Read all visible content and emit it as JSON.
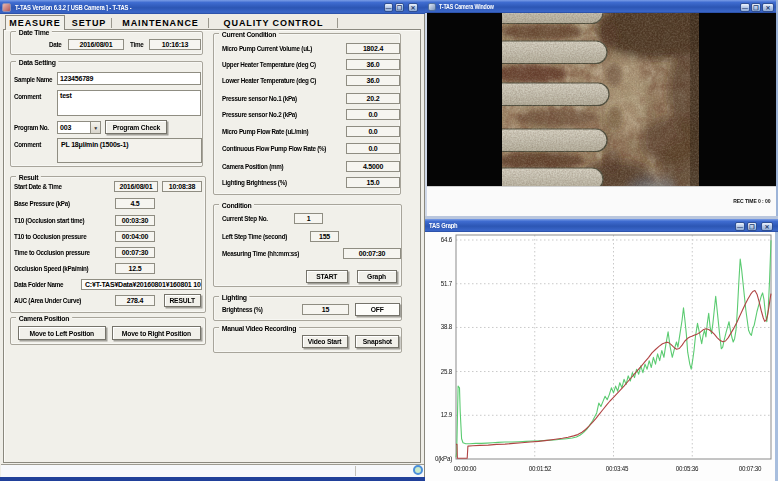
{
  "main_window": {
    "title": "T-TAS Version 6.3.2 [ USB Camera ] - T-TAS -",
    "window_buttons": {
      "minimize": "—",
      "maximize": "❐",
      "close": "✕"
    },
    "tabs": [
      {
        "label": "MEASURE",
        "active": true
      },
      {
        "label": "SETUP",
        "active": false
      },
      {
        "label": "MAINTENANCE",
        "active": false
      },
      {
        "label": "QUALITY CONTROL",
        "active": false
      }
    ],
    "date_time": {
      "title": "Date Time",
      "date_label": "Date",
      "date_value": "2016/08/01",
      "time_label": "Time",
      "time_value": "10:16:13"
    },
    "data_setting": {
      "title": "Data Setting",
      "sample_name_label": "Sample Name",
      "sample_name_value": "123456789",
      "comment_label": "Comment",
      "comment_value": "test",
      "program_no_label": "Program No.",
      "program_no_value": "003",
      "program_check_button": "Program Check",
      "program_comment_label": "Comment",
      "program_comment_value": "PL 18μl/min (1500s-1)"
    },
    "result": {
      "title": "Result",
      "rows": [
        {
          "label": "Start Date & Time",
          "value": "2016/08/01",
          "value2": "10:08:38"
        },
        {
          "label": "Base Pressure (kPa)",
          "value": "4.5"
        },
        {
          "label": "T10 (Occlusion start time)",
          "value": "00:03:30"
        },
        {
          "label": "T10 to Occlusion pressure",
          "value": "00:04:00"
        },
        {
          "label": "Time to Occlusion pressure",
          "value": "00:07:30"
        },
        {
          "label": "Occlusion Speed (kPa/min)",
          "value": "12.5"
        },
        {
          "label": "Data Folder Name",
          "value": "C:¥T-TAS¥Data¥20160801¥160801 10"
        },
        {
          "label": "AUC (Area Under Curve)",
          "value": "278.4"
        }
      ],
      "result_button": "RESULT"
    },
    "camera_position": {
      "title": "Camera Position",
      "left_button": "Move to Left Position",
      "right_button": "Move to Right Position"
    },
    "current_condition": {
      "title": "Current Condition",
      "rows": [
        {
          "label": "Micro Pump Current Volume (uL)",
          "value": "1802.4"
        },
        {
          "label": "Upper Heater Temperature (deg C)",
          "value": "36.0"
        },
        {
          "label": "Lower Heater Temperature (deg C)",
          "value": "36.0"
        },
        {
          "label": "Pressure sensor No.1 (kPa)",
          "value": "20.2"
        },
        {
          "label": "Pressure sensor No.2 (kPa)",
          "value": "0.0"
        },
        {
          "label": "Micro Pump Flow Rate (uL/min)",
          "value": "0.0"
        },
        {
          "label": "Continuous Flow Pump Flow Rate (%)",
          "value": "0.0"
        },
        {
          "label": "Camera Position (mm)",
          "value": "4.5000"
        },
        {
          "label": "Lighting Brightness (%)",
          "value": "15.0"
        }
      ]
    },
    "condition": {
      "title": "Condition",
      "current_step_label": "Current Step No.",
      "current_step_value": "1",
      "left_step_label": "Left Step Time (second)",
      "left_step_value": "155",
      "measuring_label": "Measuring Time (hh:mm:ss)",
      "measuring_value": "00:07:30",
      "start_button": "START",
      "graph_button": "Graph"
    },
    "lighting": {
      "title": "Lighting",
      "brightness_label": "Brightness (%)",
      "brightness_value": "15",
      "off_button": "OFF"
    },
    "video": {
      "title": "Manual Video Recording",
      "video_start_button": "Video Start",
      "snapshot_button": "Snapshot"
    }
  },
  "camera_window": {
    "title": "T-TAS Camera Window",
    "rec_time": "REC TIME 0 : 00"
  },
  "graph_window": {
    "title": "TAS Graph"
  },
  "chart_data": {
    "type": "line",
    "title": "",
    "xlabel": "",
    "ylabel": "kPa",
    "x_ticks": [
      "00:00:00",
      "00:01:52",
      "00:03:45",
      "00:05:36",
      "00:07:30"
    ],
    "y_ticks": [
      "0(kPa)",
      "12.9",
      "25.8",
      "38.8",
      "51.7",
      "64.6"
    ],
    "y_tick_values": [
      0,
      12.9,
      25.8,
      38.8,
      51.7,
      64.6
    ],
    "x_range_seconds": [
      0,
      450
    ],
    "ylim": [
      0,
      66
    ],
    "grid": true,
    "series": [
      {
        "name": "flow-pressure-green",
        "color": "#5bcb71",
        "points": [
          [
            0,
            0.5
          ],
          [
            1,
            2
          ],
          [
            3,
            21.5
          ],
          [
            5,
            21
          ],
          [
            6,
            14
          ],
          [
            8,
            6
          ],
          [
            10,
            4.8
          ],
          [
            14,
            4.5
          ],
          [
            20,
            4.5
          ],
          [
            28,
            4.6
          ],
          [
            36,
            4.6
          ],
          [
            44,
            4.7
          ],
          [
            52,
            4.8
          ],
          [
            60,
            4.9
          ],
          [
            70,
            5.0
          ],
          [
            80,
            5.0
          ],
          [
            90,
            5.1
          ],
          [
            100,
            5.2
          ],
          [
            110,
            5.3
          ],
          [
            120,
            5.4
          ],
          [
            130,
            5.5
          ],
          [
            140,
            5.6
          ],
          [
            150,
            5.8
          ],
          [
            158,
            6.0
          ],
          [
            166,
            6.2
          ],
          [
            172,
            6.5
          ],
          [
            177,
            7.0
          ],
          [
            182,
            7.8
          ],
          [
            187,
            8.8
          ],
          [
            191,
            10.0
          ],
          [
            195,
            11.2
          ],
          [
            198,
            12.4
          ],
          [
            201,
            13.6
          ],
          [
            204,
            16.5
          ],
          [
            207,
            15.5
          ],
          [
            210,
            17.0
          ],
          [
            213,
            18.5
          ],
          [
            216,
            17.5
          ],
          [
            219,
            19.0
          ],
          [
            222,
            21.0
          ],
          [
            225,
            19.5
          ],
          [
            228,
            21.5
          ],
          [
            231,
            20.0
          ],
          [
            234,
            22.5
          ],
          [
            237,
            21.0
          ],
          [
            240,
            23.5
          ],
          [
            243,
            22.0
          ],
          [
            246,
            24.5
          ],
          [
            249,
            23.0
          ],
          [
            252,
            25.5
          ],
          [
            255,
            24.0
          ],
          [
            258,
            26.5
          ],
          [
            261,
            25.0
          ],
          [
            264,
            27.5
          ],
          [
            267,
            25.5
          ],
          [
            270,
            28.0
          ],
          [
            273,
            26.5
          ],
          [
            276,
            29.0
          ],
          [
            279,
            27.0
          ],
          [
            282,
            30.0
          ],
          [
            285,
            28.0
          ],
          [
            288,
            31.0
          ],
          [
            291,
            29.0
          ],
          [
            294,
            32.0
          ],
          [
            297,
            30.0
          ],
          [
            300,
            34.0
          ],
          [
            303,
            37.5
          ],
          [
            306,
            33.0
          ],
          [
            309,
            30.0
          ],
          [
            312,
            32.5
          ],
          [
            315,
            34.5
          ],
          [
            317,
            33.0
          ],
          [
            320,
            37.0
          ],
          [
            323,
            41.0
          ],
          [
            325,
            44.6
          ],
          [
            327,
            41.0
          ],
          [
            329,
            37.0
          ],
          [
            331,
            31.5
          ],
          [
            334,
            28.0
          ],
          [
            336,
            26.5
          ],
          [
            338,
            29.0
          ],
          [
            340,
            32.0
          ],
          [
            342,
            36.0
          ],
          [
            345,
            40.0
          ],
          [
            347,
            38.0
          ],
          [
            349,
            36.0
          ],
          [
            351,
            34.0
          ],
          [
            353,
            36.5
          ],
          [
            355,
            38.0
          ],
          [
            357,
            36.0
          ],
          [
            359,
            40.0
          ],
          [
            361,
            43.0
          ],
          [
            363,
            39.0
          ],
          [
            365,
            37.0
          ],
          [
            367,
            40.0
          ],
          [
            369,
            44.0
          ],
          [
            371,
            48.0
          ],
          [
            373,
            44.0
          ],
          [
            375,
            40.0
          ],
          [
            377,
            36.0
          ],
          [
            379,
            32.5
          ],
          [
            381,
            33.0
          ],
          [
            383,
            35.0
          ],
          [
            386,
            37.5
          ],
          [
            388,
            39.0
          ],
          [
            390,
            40.5
          ],
          [
            392,
            38.0
          ],
          [
            394,
            36.0
          ],
          [
            396,
            34.5
          ],
          [
            398,
            35.5
          ],
          [
            400,
            38.0
          ],
          [
            402,
            44.0
          ],
          [
            404,
            52.0
          ],
          [
            406,
            59.0
          ],
          [
            408,
            56.0
          ],
          [
            410,
            52.0
          ],
          [
            412,
            48.0
          ],
          [
            414,
            44.0
          ],
          [
            416,
            41.0
          ],
          [
            418,
            38.0
          ],
          [
            420,
            37.0
          ],
          [
            422,
            36.5
          ],
          [
            424,
            38.5
          ],
          [
            426,
            39.5
          ],
          [
            428,
            41.5
          ],
          [
            430,
            43.5
          ],
          [
            432,
            45.0
          ],
          [
            434,
            46.5
          ],
          [
            436,
            48.0
          ],
          [
            438,
            49.0
          ],
          [
            440,
            47.0
          ],
          [
            442,
            43.0
          ],
          [
            444,
            40.5
          ],
          [
            446,
            44.0
          ],
          [
            448,
            53.0
          ],
          [
            450,
            64.5
          ]
        ]
      },
      {
        "name": "flow-pressure-red",
        "color": "#b04444",
        "points": [
          [
            0,
            4.3
          ],
          [
            1.5,
            4.3
          ],
          [
            2,
            0.2
          ],
          [
            16,
            0.2
          ],
          [
            17,
            3.8
          ],
          [
            24,
            3.9
          ],
          [
            34,
            4.0
          ],
          [
            46,
            4.1
          ],
          [
            58,
            4.3
          ],
          [
            70,
            4.4
          ],
          [
            82,
            4.6
          ],
          [
            94,
            4.8
          ],
          [
            106,
            5.0
          ],
          [
            118,
            5.2
          ],
          [
            130,
            5.5
          ],
          [
            142,
            5.8
          ],
          [
            152,
            6.1
          ],
          [
            160,
            6.4
          ],
          [
            168,
            6.8
          ],
          [
            174,
            7.2
          ],
          [
            180,
            7.9
          ],
          [
            185,
            8.7
          ],
          [
            190,
            9.7
          ],
          [
            195,
            10.8
          ],
          [
            200,
            12.0
          ],
          [
            205,
            13.3
          ],
          [
            210,
            14.6
          ],
          [
            215,
            15.9
          ],
          [
            220,
            17.1
          ],
          [
            225,
            18.2
          ],
          [
            230,
            19.3
          ],
          [
            235,
            20.4
          ],
          [
            240,
            21.5
          ],
          [
            245,
            22.7
          ],
          [
            250,
            23.9
          ],
          [
            255,
            25.1
          ],
          [
            260,
            26.3
          ],
          [
            265,
            27.5
          ],
          [
            270,
            28.7
          ],
          [
            275,
            29.9
          ],
          [
            280,
            31.3
          ],
          [
            285,
            32.3
          ],
          [
            290,
            33.2
          ],
          [
            295,
            34.0
          ],
          [
            300,
            34.4
          ],
          [
            303,
            34.4
          ],
          [
            307,
            33.8
          ],
          [
            311,
            33.0
          ],
          [
            315,
            32.4
          ],
          [
            319,
            32.6
          ],
          [
            323,
            33.6
          ],
          [
            327,
            34.8
          ],
          [
            331,
            35.6
          ],
          [
            334,
            36.0
          ],
          [
            337,
            36.2
          ],
          [
            341,
            36.6
          ],
          [
            345,
            36.9
          ],
          [
            349,
            37.4
          ],
          [
            353,
            38.1
          ],
          [
            357,
            38.4
          ],
          [
            361,
            38.2
          ],
          [
            365,
            37.6
          ],
          [
            369,
            36.8
          ],
          [
            373,
            35.8
          ],
          [
            377,
            35.0
          ],
          [
            381,
            34.6
          ],
          [
            385,
            34.8
          ],
          [
            389,
            35.8
          ],
          [
            393,
            37.2
          ],
          [
            397,
            38.6
          ],
          [
            401,
            40.2
          ],
          [
            405,
            42.0
          ],
          [
            409,
            43.8
          ],
          [
            413,
            45.6
          ],
          [
            417,
            47.2
          ],
          [
            421,
            48.6
          ],
          [
            424,
            49.4
          ],
          [
            427,
            49.7
          ],
          [
            430,
            48.6
          ],
          [
            433,
            46.4
          ],
          [
            436,
            43.8
          ],
          [
            439,
            41.6
          ],
          [
            441,
            40.6
          ],
          [
            443,
            40.9
          ],
          [
            445,
            42.4
          ],
          [
            447,
            44.8
          ],
          [
            449,
            47.6
          ],
          [
            450,
            48.8
          ]
        ]
      }
    ]
  }
}
